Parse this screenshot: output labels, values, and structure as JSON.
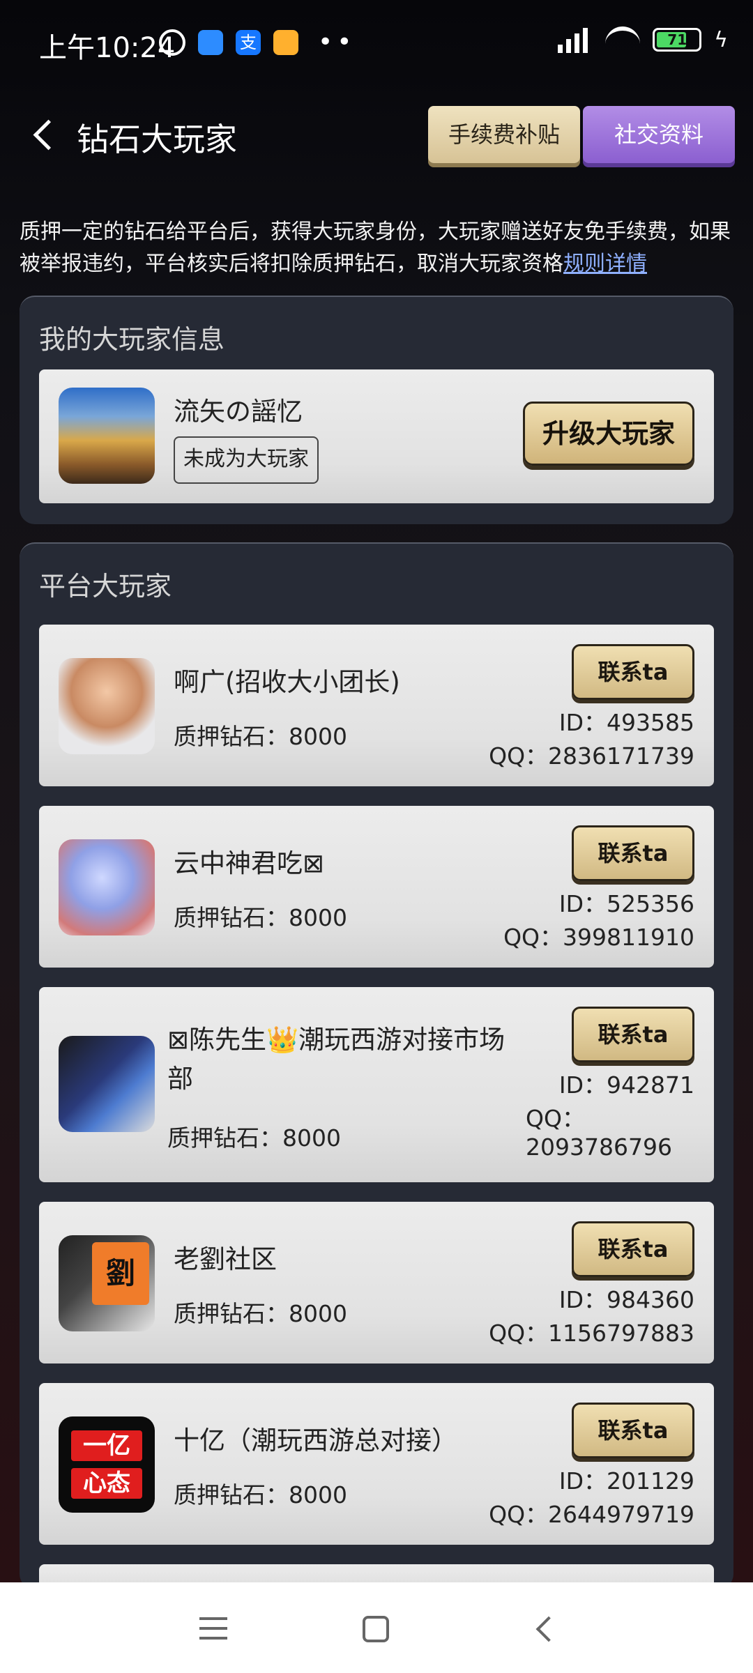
{
  "status_bar": {
    "time": "上午10:24",
    "battery": "71"
  },
  "header": {
    "title": "钻石大玩家",
    "fee_button": "手续费补贴",
    "social_button": "社交资料"
  },
  "description": {
    "text": "质押一定的钻石给平台后，获得大玩家身份，大玩家赠送好友免手续费，如果被举报违约，平台核实后将扣除质押钻石，取消大玩家资格",
    "link": "规则详情"
  },
  "my_info": {
    "title": "我的大玩家信息",
    "name": "流矢の謡忆",
    "status": "未成为大玩家",
    "upgrade_button": "升级大玩家"
  },
  "platform": {
    "title": "平台大玩家",
    "contact_label": "联系ta",
    "players": [
      {
        "name": "啊广(招收大小团长)",
        "stake": "质押钻石：8000",
        "id": "ID：493585",
        "qq": "QQ：2836171739"
      },
      {
        "name": "云中神君吃⊠",
        "stake": "质押钻石：8000",
        "id": "ID：525356",
        "qq": "QQ：399811910"
      },
      {
        "name": "⊠陈先生👑潮玩西游对接市场部",
        "stake": "质押钻石：8000",
        "id": "ID：942871",
        "qq_label": "QQ：",
        "qq_value": "2093786796"
      },
      {
        "name": "老劉社区",
        "stake": "质押钻石：8000",
        "id": "ID：984360",
        "qq": "QQ：1156797883",
        "avatar_text": "劉"
      },
      {
        "name": "十亿（潮玩西游总对接）",
        "stake": "质押钻石：8000",
        "id": "ID：201129",
        "qq": "QQ：2644979719",
        "avatar_text_1": "一亿",
        "avatar_text_2": "心态"
      }
    ]
  }
}
